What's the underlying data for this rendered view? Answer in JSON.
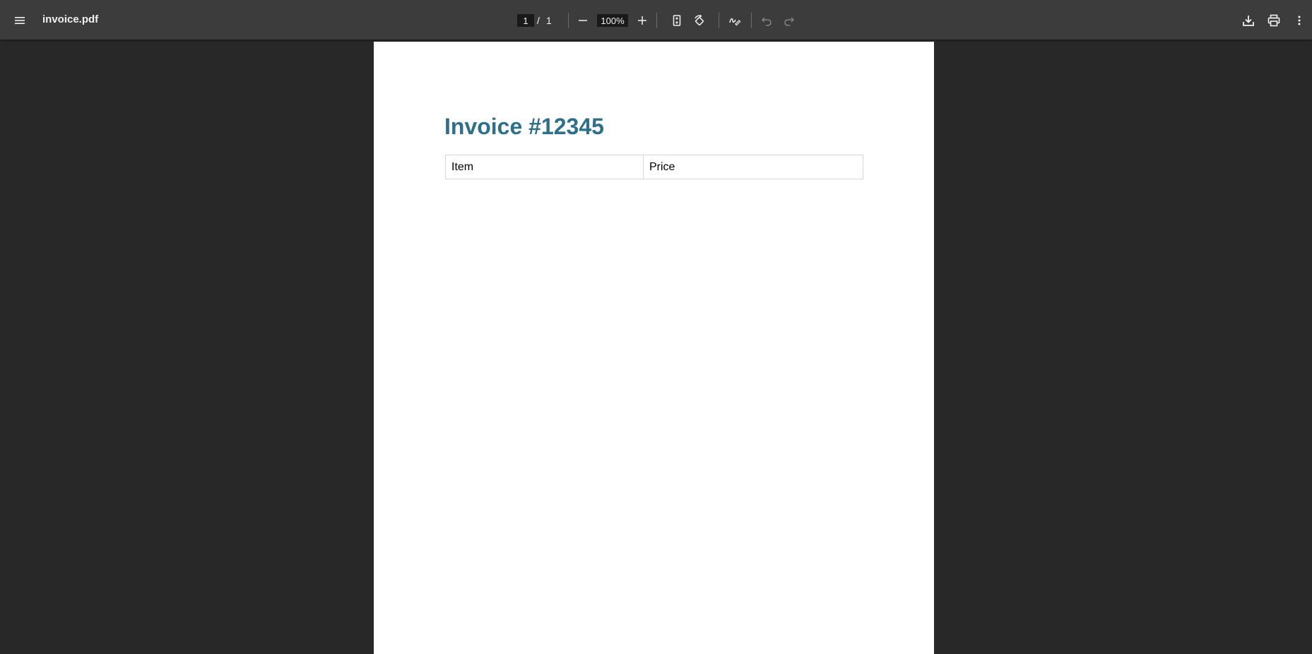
{
  "toolbar": {
    "menu_icon": "menu-icon",
    "file_name": "invoice.pdf",
    "page_current": "1",
    "page_separator": "/",
    "page_total": "1",
    "zoom_value": "100%",
    "icons": {
      "zoom_out": "minus-icon",
      "zoom_in": "plus-icon",
      "fit": "fit-page-icon",
      "rotate": "rotate-icon",
      "annotate": "draw-icon",
      "undo": "undo-icon",
      "redo": "redo-icon",
      "download": "download-icon",
      "print": "print-icon",
      "more": "more-vertical-icon"
    }
  },
  "document": {
    "title": "Invoice #12345",
    "table": {
      "rows": [
        [
          "Item",
          "Price"
        ]
      ]
    },
    "colors": {
      "title": "#2e6f8a",
      "page_background": "#ffffff",
      "viewer_background": "#282828",
      "toolbar_background": "#3c3c3c"
    }
  }
}
